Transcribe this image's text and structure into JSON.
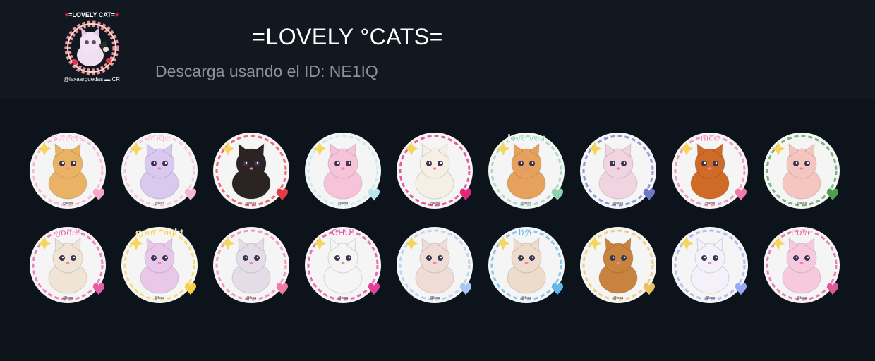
{
  "pack": {
    "title": "=LOVELY °CATS=",
    "download_text": "Descarga usando el ID: NE1IQ",
    "thumb_top": "=LOVELY CAT=",
    "thumb_bottom": "@lexaarguedas"
  },
  "stickers_row1": [
    {
      "name": "sticker-puppy-sweets",
      "icon": "puppy-cupcake",
      "body": "#e9b264",
      "accent": "#f6a6c8",
      "word": "Sweets"
    },
    {
      "name": "sticker-kitten-angel-moon",
      "icon": "kitten-moon-wreath",
      "body": "#d9c8ef",
      "accent": "#f3b6d3",
      "word": "Angel"
    },
    {
      "name": "sticker-black-kitten-apple",
      "icon": "black-kitten",
      "body": "#2b2423",
      "accent": "#e53946",
      "word": ""
    },
    {
      "name": "sticker-rainbow",
      "icon": "rainbow",
      "body": "#f7c3d8",
      "accent": "#b9e5f1",
      "word": ""
    },
    {
      "name": "sticker-kitten-crown-bow",
      "icon": "kitten-crown",
      "body": "#f6efe6",
      "accent": "#e2277a",
      "word": ""
    },
    {
      "name": "sticker-puppy-love-you",
      "icon": "puppy-hearts",
      "body": "#e6a15d",
      "accent": "#8fd3ae",
      "word": "love you"
    },
    {
      "name": "sticker-kitten-night-sky",
      "icon": "kitten-stars",
      "body": "#f0d4df",
      "accent": "#6f77c9",
      "word": ""
    },
    {
      "name": "sticker-puppy-nico",
      "icon": "puppy-nico",
      "body": "#cf6a27",
      "accent": "#f07aa8",
      "word": "nico"
    },
    {
      "name": "sticker-bunny-basket",
      "icon": "bunny-basket",
      "body": "#f5c6c0",
      "accent": "#4d9e4f",
      "word": ""
    }
  ],
  "stickers_row2": [
    {
      "name": "sticker-kitten-good",
      "icon": "kitten-good",
      "body": "#efe4d6",
      "accent": "#e65ca6",
      "word": "good!"
    },
    {
      "name": "sticker-kitten-good-night",
      "icon": "kitten-moon",
      "body": "#e8c7ea",
      "accent": "#f5d04a",
      "word": "good night"
    },
    {
      "name": "sticker-kitten-flowers",
      "icon": "kitten-flowers",
      "body": "#e4dde7",
      "accent": "#f07aa8",
      "word": ""
    },
    {
      "name": "sticker-kitten-chu",
      "icon": "kitten-kiss",
      "body": "#f5f5f5",
      "accent": "#e0409a",
      "word": "CHU!"
    },
    {
      "name": "sticker-kitten-pearl-frame",
      "icon": "kitten-frame",
      "body": "#efdcd6",
      "accent": "#a7c8ef",
      "word": ""
    },
    {
      "name": "sticker-kitten-bye",
      "icon": "kitten-bye",
      "body": "#eddccb",
      "accent": "#62b6e8",
      "word": "bye"
    },
    {
      "name": "sticker-pony-crown",
      "icon": "pony",
      "body": "#c8833f",
      "accent": "#e9c25f",
      "word": ""
    },
    {
      "name": "sticker-unicorn",
      "icon": "unicorn",
      "body": "#f4f1fb",
      "accent": "#9aa8f5",
      "word": ""
    },
    {
      "name": "sticker-love-lipstick",
      "icon": "lipstick",
      "body": "#f6c9dc",
      "accent": "#e05a9a",
      "word": "Love"
    }
  ]
}
